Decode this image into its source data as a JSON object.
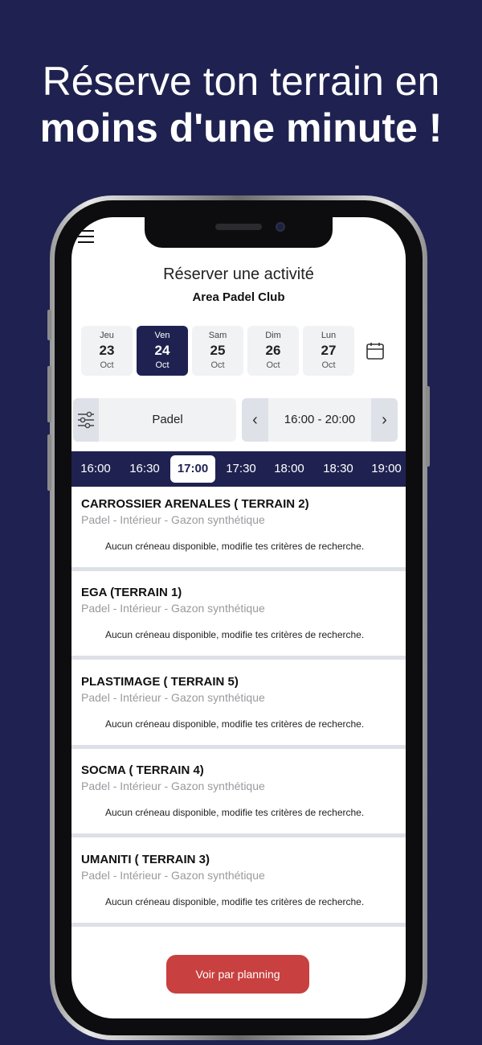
{
  "headline": {
    "line1": "Réserve ton terrain en",
    "line2": "moins d'une minute !"
  },
  "colors": {
    "primary": "#1f2250",
    "accent": "#c8403f",
    "muted": "#9a9a9f"
  },
  "app": {
    "title": "Réserver une activité",
    "club": "Area Padel Club",
    "days": [
      {
        "name": "Jeu",
        "date": "23",
        "month": "Oct",
        "selected": false
      },
      {
        "name": "Ven",
        "date": "24",
        "month": "Oct",
        "selected": true
      },
      {
        "name": "Sam",
        "date": "25",
        "month": "Oct",
        "selected": false
      },
      {
        "name": "Dim",
        "date": "26",
        "month": "Oct",
        "selected": false
      },
      {
        "name": "Lun",
        "date": "27",
        "month": "Oct",
        "selected": false
      }
    ],
    "filter": {
      "icon": "sliders-icon",
      "label": "Padel"
    },
    "time_range": {
      "label": "16:00 - 20:00",
      "prev_icon": "chevron-left-icon",
      "next_icon": "chevron-right-icon"
    },
    "time_slots": [
      "16:00",
      "16:30",
      "17:00",
      "17:30",
      "18:00",
      "18:30",
      "19:00"
    ],
    "selected_slot": "17:00",
    "courts": [
      {
        "name": "CARROSSIER ARENALES ( TERRAIN 2)",
        "info": "Padel - Intérieur  - Gazon synthétique",
        "message": "Aucun créneau disponible, modifie tes critères de recherche."
      },
      {
        "name": "EGA (TERRAIN 1)",
        "info": "Padel - Intérieur  - Gazon synthétique",
        "message": "Aucun créneau disponible, modifie tes critères de recherche."
      },
      {
        "name": "PLASTIMAGE ( TERRAIN 5)",
        "info": "Padel - Intérieur  - Gazon synthétique",
        "message": "Aucun créneau disponible, modifie tes critères de recherche."
      },
      {
        "name": "SOCMA ( TERRAIN 4)",
        "info": "Padel - Intérieur  - Gazon synthétique",
        "message": "Aucun créneau disponible, modifie tes critères de recherche."
      },
      {
        "name": "UMANITI ( TERRAIN 3)",
        "info": "Padel - Intérieur  - Gazon synthétique",
        "message": "Aucun créneau disponible, modifie tes critères de recherche."
      }
    ],
    "planning_button": "Voir par planning"
  }
}
